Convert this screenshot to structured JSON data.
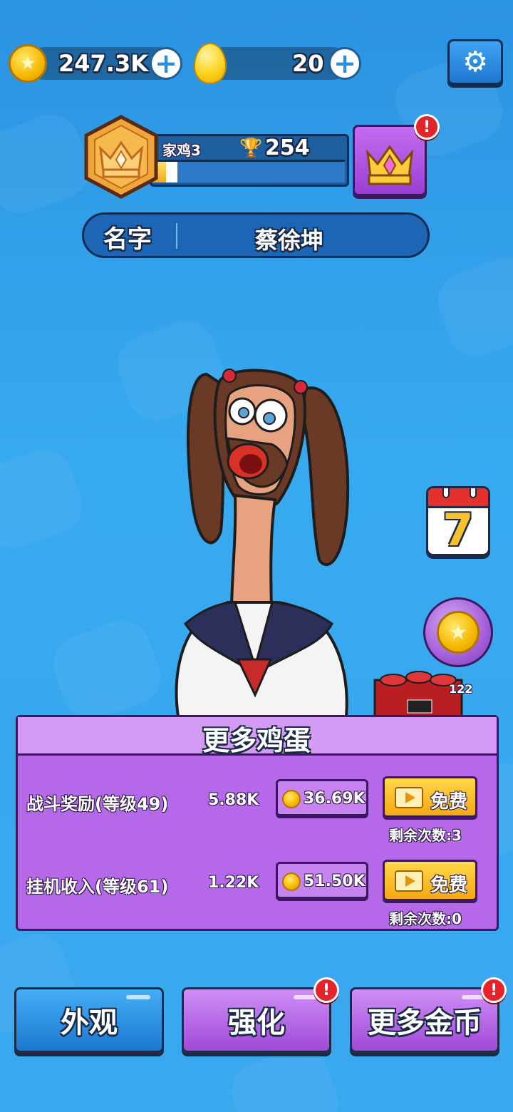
{
  "currency": {
    "coins": "247.3K",
    "eggs": "20",
    "coin_icon": "star-coin-icon",
    "egg_icon": "golden-egg-icon",
    "plus_icon": "plus-icon"
  },
  "settings": {
    "icon": "gear-icon",
    "glyph": "⚙"
  },
  "rank": {
    "name": "家鸡3",
    "trophies": "254",
    "trophy_glyph": "🏆",
    "xp_progress": 0.13,
    "badge_icon": "crown-rank-badge-icon"
  },
  "crown_button": {
    "icon": "crown-icon",
    "alert": "!"
  },
  "player": {
    "name_label": "名字",
    "name_value": "蔡徐坤"
  },
  "side_buttons": {
    "calendar_day": "7",
    "calendar_icon": "calendar-icon",
    "coin_bubble_icon": "coin-bubble-icon",
    "coin_glyph": "★",
    "dynamite_count": "122",
    "dynamite_icon": "dynamite-icon"
  },
  "egg_panel": {
    "title": "更多鸡蛋",
    "rows": [
      {
        "label": "战斗奖励(等级49)",
        "value": "5.88K",
        "cost": "36.69K",
        "free": "免费",
        "remaining": "剩余次数:3"
      },
      {
        "label": "挂机收入(等级61)",
        "value": "1.22K",
        "cost": "51.50K",
        "free": "免费",
        "remaining": "剩余次数:0"
      }
    ]
  },
  "bottom_nav": {
    "appearance": "外观",
    "upgrade": "强化",
    "more_coins": "更多金币",
    "alert": "!"
  },
  "colors": {
    "background": "#37a9ef",
    "panel_purple": "#b569e8",
    "dark_outline": "#1d2a45",
    "gold": "#f5b800",
    "alert_red": "#e5232b"
  }
}
